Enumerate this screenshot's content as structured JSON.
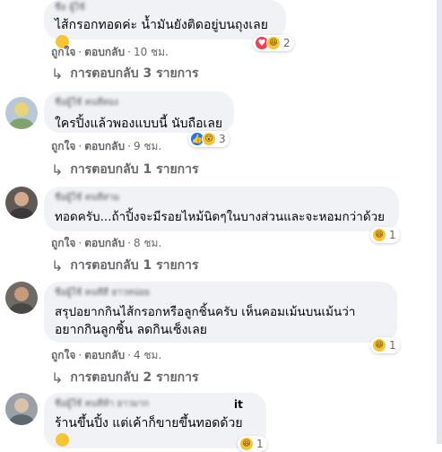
{
  "comments": [
    {
      "author": "ชื่อ ผู้ใช้",
      "text": "ไส้กรอกทอดค่ะ น้ำมันยังติดอยู่บนถุงเลย",
      "like": "ถูกใจ",
      "reply": "ตอบกลับ",
      "time": "10 ชม.",
      "reaction_count": "2",
      "reactions": [
        "love-icon",
        "haha-icon"
      ],
      "replies": "การตอบกลับ 3 รายการ"
    },
    {
      "author": "ชื่อผู้ใช้ คนที่สอง",
      "text": "ใครปิ้งแล้วพองแบบนี้ นับถือเลย",
      "like": "ถูกใจ",
      "reply": "ตอบกลับ",
      "time": "9 ชม.",
      "reaction_count": "3",
      "reactions": [
        "like-icon",
        "wow-icon"
      ],
      "replies": "การตอบกลับ 1 รายการ"
    },
    {
      "author": "ชื่อผู้ใช้ คนที่สาม",
      "text": "ทอดครับ...ถ้าปิ้งจะมีรอยไหม้นิดๆในบางส่วนและจะหอมกว่าด้วย",
      "like": "ถูกใจ",
      "reply": "ตอบกลับ",
      "time": "8 ชม.",
      "reaction_count": "1",
      "reactions": [
        "haha-icon"
      ],
      "replies": "การตอบกลับ 1 รายการ"
    },
    {
      "author": "ชื่อผู้ใช้ คนที่สี่ ยาวหน่อย",
      "text_line1": "สรุปอยากกินไส้กรอกหรือลูกชิ้นครับ เห็นคอมเม้นบนเม้นว่า",
      "text_line2": "อยากกินลูกชิ้น ลดกินเซ็งเลย",
      "like": "ถูกใจ",
      "reply": "ตอบกลับ",
      "time": "4 ชม.",
      "reaction_count": "1",
      "reactions": [
        "haha-icon"
      ],
      "replies": "การตอบกลับ 2 รายการ"
    },
    {
      "author": "ชื่อผู้ใช้ คนที่ห้า ยาวมาก",
      "author_suffix": "it",
      "text": "ร้านขึ้นปิ้ง แต่เค้าก็ขายขึ้นทอดด้วย",
      "reaction_count": "1",
      "reactions": [
        "haha-icon"
      ]
    }
  ],
  "colors": {
    "bubble": "#f0f2f5",
    "meta_text": "#65676b",
    "like_blue": "#1877f2",
    "love_red": "#f33e58",
    "haha_yellow": "#f7c531"
  }
}
